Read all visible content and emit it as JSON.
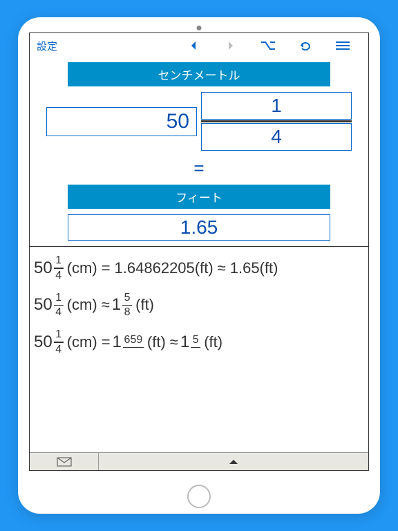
{
  "toolbar": {
    "settings_label": "設定"
  },
  "convert": {
    "from_unit": "センチメートル",
    "to_unit": "フィート",
    "whole": "50",
    "numerator": "1",
    "denominator": "4",
    "equals": "=",
    "result": "1.65"
  },
  "history": {
    "lines": [
      {
        "lhs_whole": "50",
        "lhs_num": "1",
        "lhs_den": "4",
        "lhs_unit": "(cm)",
        "rel1": "=",
        "mid": "1.64862205(ft)",
        "rel2": "≈",
        "rhs": "1.65(ft)"
      },
      {
        "lhs_whole": "50",
        "lhs_num": "1",
        "lhs_den": "4",
        "lhs_unit": "(cm)",
        "rel1": "≈",
        "r_whole": "1",
        "r_num": "5",
        "r_den": "8",
        "r_unit": "(ft)"
      },
      {
        "lhs_whole": "50",
        "lhs_num": "1",
        "lhs_den": "4",
        "lhs_unit": "(cm)",
        "rel1": "=",
        "r_whole": "1",
        "r_num": "659",
        "r_den": " ",
        "r_unit": "(ft)",
        "rel2": "≈",
        "r2_whole": "1",
        "r2_num": "5",
        "r2_den": " ",
        "r2_unit": "(ft)"
      }
    ]
  }
}
